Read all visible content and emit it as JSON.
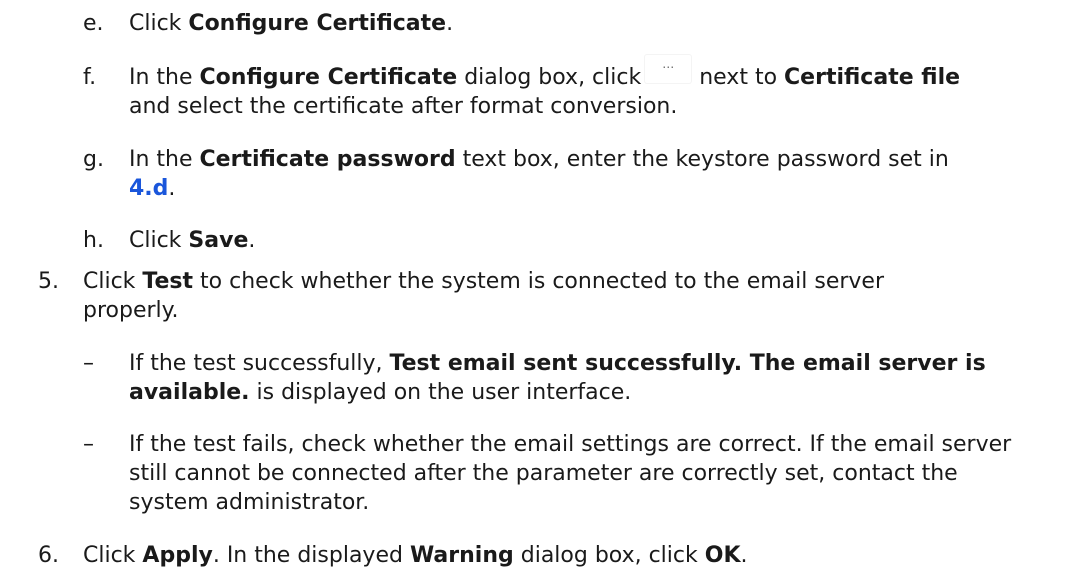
{
  "steps": {
    "e": {
      "marker": "e.",
      "t1": "Click ",
      "b1": "Configure Certificate",
      "t2": "."
    },
    "f": {
      "marker": "f.",
      "t1": "In the ",
      "b1": "Configure Certificate",
      "t2": " dialog box, click",
      "button_glyph": "…",
      "t3": "next to ",
      "b2": "Certificate file",
      "t4": "and select the certificate after format conversion."
    },
    "g": {
      "marker": "g.",
      "t1": "In the ",
      "b1": "Certificate password",
      "t2": " text box, enter the keystore password set in",
      "link": "4.d",
      "t3": "."
    },
    "h": {
      "marker": "h.",
      "t1": "Click ",
      "b1": "Save",
      "t2": "."
    },
    "s5": {
      "marker": "5.",
      "t1": "Click ",
      "b1": "Test",
      "t2": " to check whether the system is connected to the email server properly.",
      "bullets": [
        {
          "marker": "–",
          "t1": "If the test successfully, ",
          "b1": "Test email sent successfully. The email server is available.",
          "t2": " is displayed on the user interface."
        },
        {
          "marker": "–",
          "t1": "If the test fails, check whether the email settings are correct. If the email server still cannot be connected after the parameter are correctly set, contact the system administrator."
        }
      ]
    },
    "s6": {
      "marker": "6.",
      "t1": "Click ",
      "b1": "Apply",
      "t2": ". In the displayed ",
      "b2": "Warning",
      "t3": " dialog box, click ",
      "b3": "OK",
      "t4": "."
    }
  },
  "colors": {
    "text": "#1a1a1a",
    "link": "#1a56db"
  },
  "icons": {
    "browse_button": "ellipsis-icon"
  }
}
